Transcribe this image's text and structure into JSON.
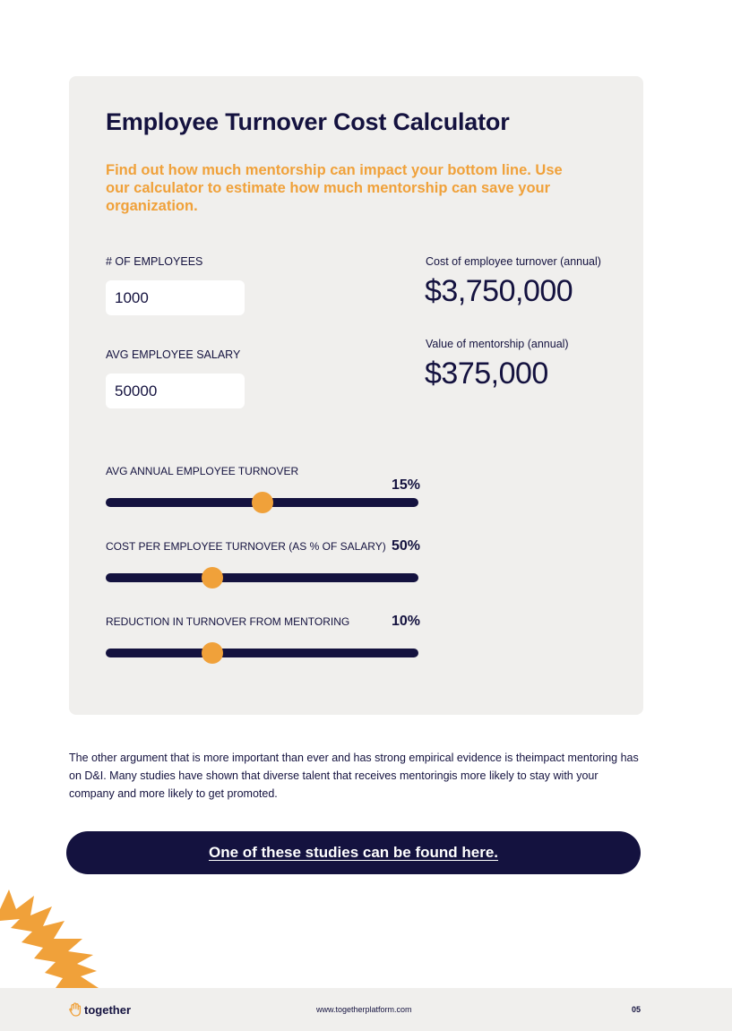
{
  "calculator": {
    "title": "Employee Turnover Cost Calculator",
    "subtitle": "Find out how much mentorship can impact your bottom line. Use our calculator to estimate how much mentorship can save your organization.",
    "employees": {
      "label": "# OF EMPLOYEES",
      "value": "1000"
    },
    "salary": {
      "label": "AVG EMPLOYEE SALARY",
      "value": "50000"
    },
    "turnover_cost": {
      "label": "Cost of employee turnover (annual)",
      "value": "$3,750,000"
    },
    "mentorship_value": {
      "label": "Value of mentorship (annual)",
      "value": "$375,000"
    },
    "sliders": [
      {
        "label": "AVG ANNUAL EMPLOYEE TURNOVER",
        "value": "15%",
        "position": 0.5
      },
      {
        "label": "COST PER EMPLOYEE TURNOVER (AS % OF SALARY)",
        "value": "50%",
        "position": 0.34
      },
      {
        "label": "REDUCTION IN TURNOVER FROM MENTORING",
        "value": "10%",
        "position": 0.34
      }
    ]
  },
  "body": {
    "paragraph": "The other argument that is more important than ever and has strong empirical evidence is theimpact mentoring has on D&I. Many studies have shown that diverse talent that receives mentoringis more likely to stay with your company and more likely to get promoted."
  },
  "cta": {
    "label": "One of these studies can be found here."
  },
  "footer": {
    "logo_text": "together",
    "logo_icon": "hand-wave-icon",
    "url": "www.togetherplatform.com",
    "page": "05"
  },
  "colors": {
    "navy": "#14123f",
    "orange": "#f0a13a",
    "card_bg": "#f0efed"
  }
}
